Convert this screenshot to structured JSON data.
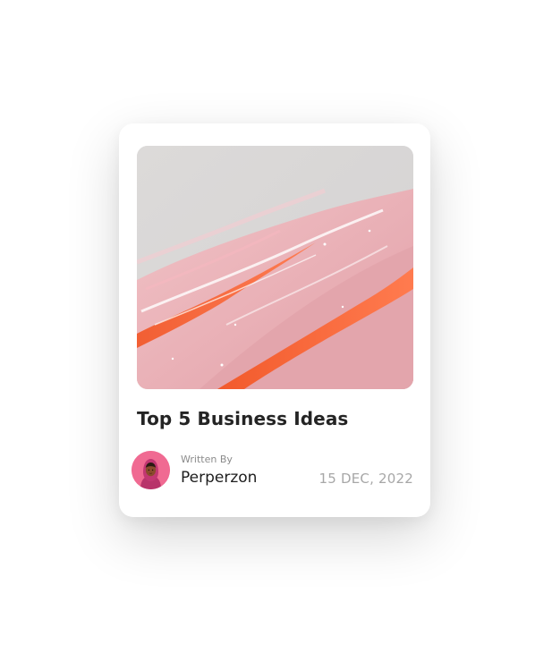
{
  "card": {
    "title": "Top 5 Business Ideas",
    "author": {
      "written_by_label": "Written By",
      "name": "Perperzon"
    },
    "date": "15 DEC, 2022"
  },
  "icons": {
    "cover": "abstract-paint-strokes-image",
    "avatar": "user-avatar-illustration"
  },
  "colors": {
    "card_bg": "#ffffff",
    "title": "#242424",
    "muted": "#a7a7a7",
    "coral": "#f06a3f",
    "pink": "#e8a3aa",
    "avatar_bg": "#f06a92"
  }
}
